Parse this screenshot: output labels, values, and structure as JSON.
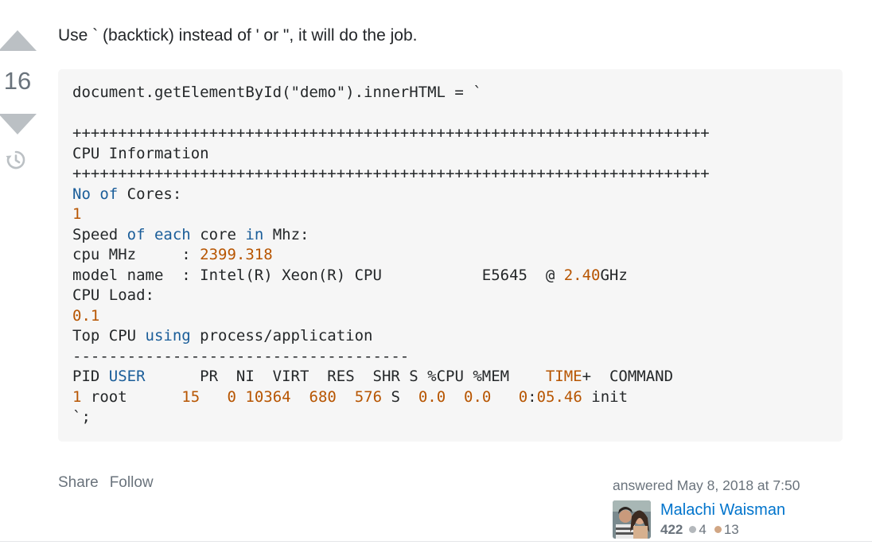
{
  "vote": {
    "count": "16"
  },
  "post": {
    "text": "Use ` (backtick) instead of ' or \", it will do the job.",
    "code_lines": [
      [
        {
          "t": "document.getElementById(\"demo\").innerHTML = `"
        }
      ],
      [
        {
          "t": ""
        }
      ],
      [
        {
          "t": "++++++++++++++++++++++++++++++++++++++++++++++++++++++++++++++++++++++"
        }
      ],
      [
        {
          "t": "CPU Information"
        }
      ],
      [
        {
          "t": "++++++++++++++++++++++++++++++++++++++++++++++++++++++++++++++++++++++"
        }
      ],
      [
        {
          "t": "No",
          "c": "kw"
        },
        {
          "t": " "
        },
        {
          "t": "of",
          "c": "kw"
        },
        {
          "t": " Cores:"
        }
      ],
      [
        {
          "t": "1",
          "c": "num"
        }
      ],
      [
        {
          "t": "Speed "
        },
        {
          "t": "of",
          "c": "kw"
        },
        {
          "t": " "
        },
        {
          "t": "each",
          "c": "kw"
        },
        {
          "t": " core "
        },
        {
          "t": "in",
          "c": "kw"
        },
        {
          "t": " Mhz:"
        }
      ],
      [
        {
          "t": "cpu MHz     : "
        },
        {
          "t": "2399.318",
          "c": "num"
        }
      ],
      [
        {
          "t": "model name  : Intel(R) Xeon(R) CPU           E5645  @ "
        },
        {
          "t": "2.40",
          "c": "num"
        },
        {
          "t": "GHz"
        }
      ],
      [
        {
          "t": "CPU Load:"
        }
      ],
      [
        {
          "t": "0.1",
          "c": "num"
        }
      ],
      [
        {
          "t": "Top CPU "
        },
        {
          "t": "using",
          "c": "kw"
        },
        {
          "t": " process/application"
        }
      ],
      [
        {
          "t": "-------------------------------------"
        }
      ],
      [
        {
          "t": "PID "
        },
        {
          "t": "USER",
          "c": "kw"
        },
        {
          "t": "      PR  NI  VIRT  RES  SHR S %CPU %MEM    "
        },
        {
          "t": "TIME",
          "c": "num"
        },
        {
          "t": "+  COMMAND"
        }
      ],
      [
        {
          "t": "1",
          "c": "num"
        },
        {
          "t": " root      "
        },
        {
          "t": "15",
          "c": "num"
        },
        {
          "t": "   "
        },
        {
          "t": "0",
          "c": "num"
        },
        {
          "t": " "
        },
        {
          "t": "10364",
          "c": "num"
        },
        {
          "t": "  "
        },
        {
          "t": "680",
          "c": "num"
        },
        {
          "t": "  "
        },
        {
          "t": "576",
          "c": "num"
        },
        {
          "t": " S  "
        },
        {
          "t": "0.0",
          "c": "num"
        },
        {
          "t": "  "
        },
        {
          "t": "0.0",
          "c": "num"
        },
        {
          "t": "   "
        },
        {
          "t": "0",
          "c": "num"
        },
        {
          "t": ":"
        },
        {
          "t": "05.46",
          "c": "num"
        },
        {
          "t": " init"
        }
      ],
      [
        {
          "t": "`;"
        }
      ]
    ]
  },
  "menu": {
    "share_label": "Share",
    "follow_label": "Follow"
  },
  "user": {
    "action_time": "answered May 8, 2018 at 7:50",
    "name": "Malachi Waisman",
    "reputation": "422",
    "silver_badges": "4",
    "bronze_badges": "13"
  },
  "colors": {
    "keyword": "#1a5d99",
    "number": "#b75501",
    "silver": "#b4b8bc",
    "bronze": "#d1a684",
    "link": "#0074cc"
  }
}
